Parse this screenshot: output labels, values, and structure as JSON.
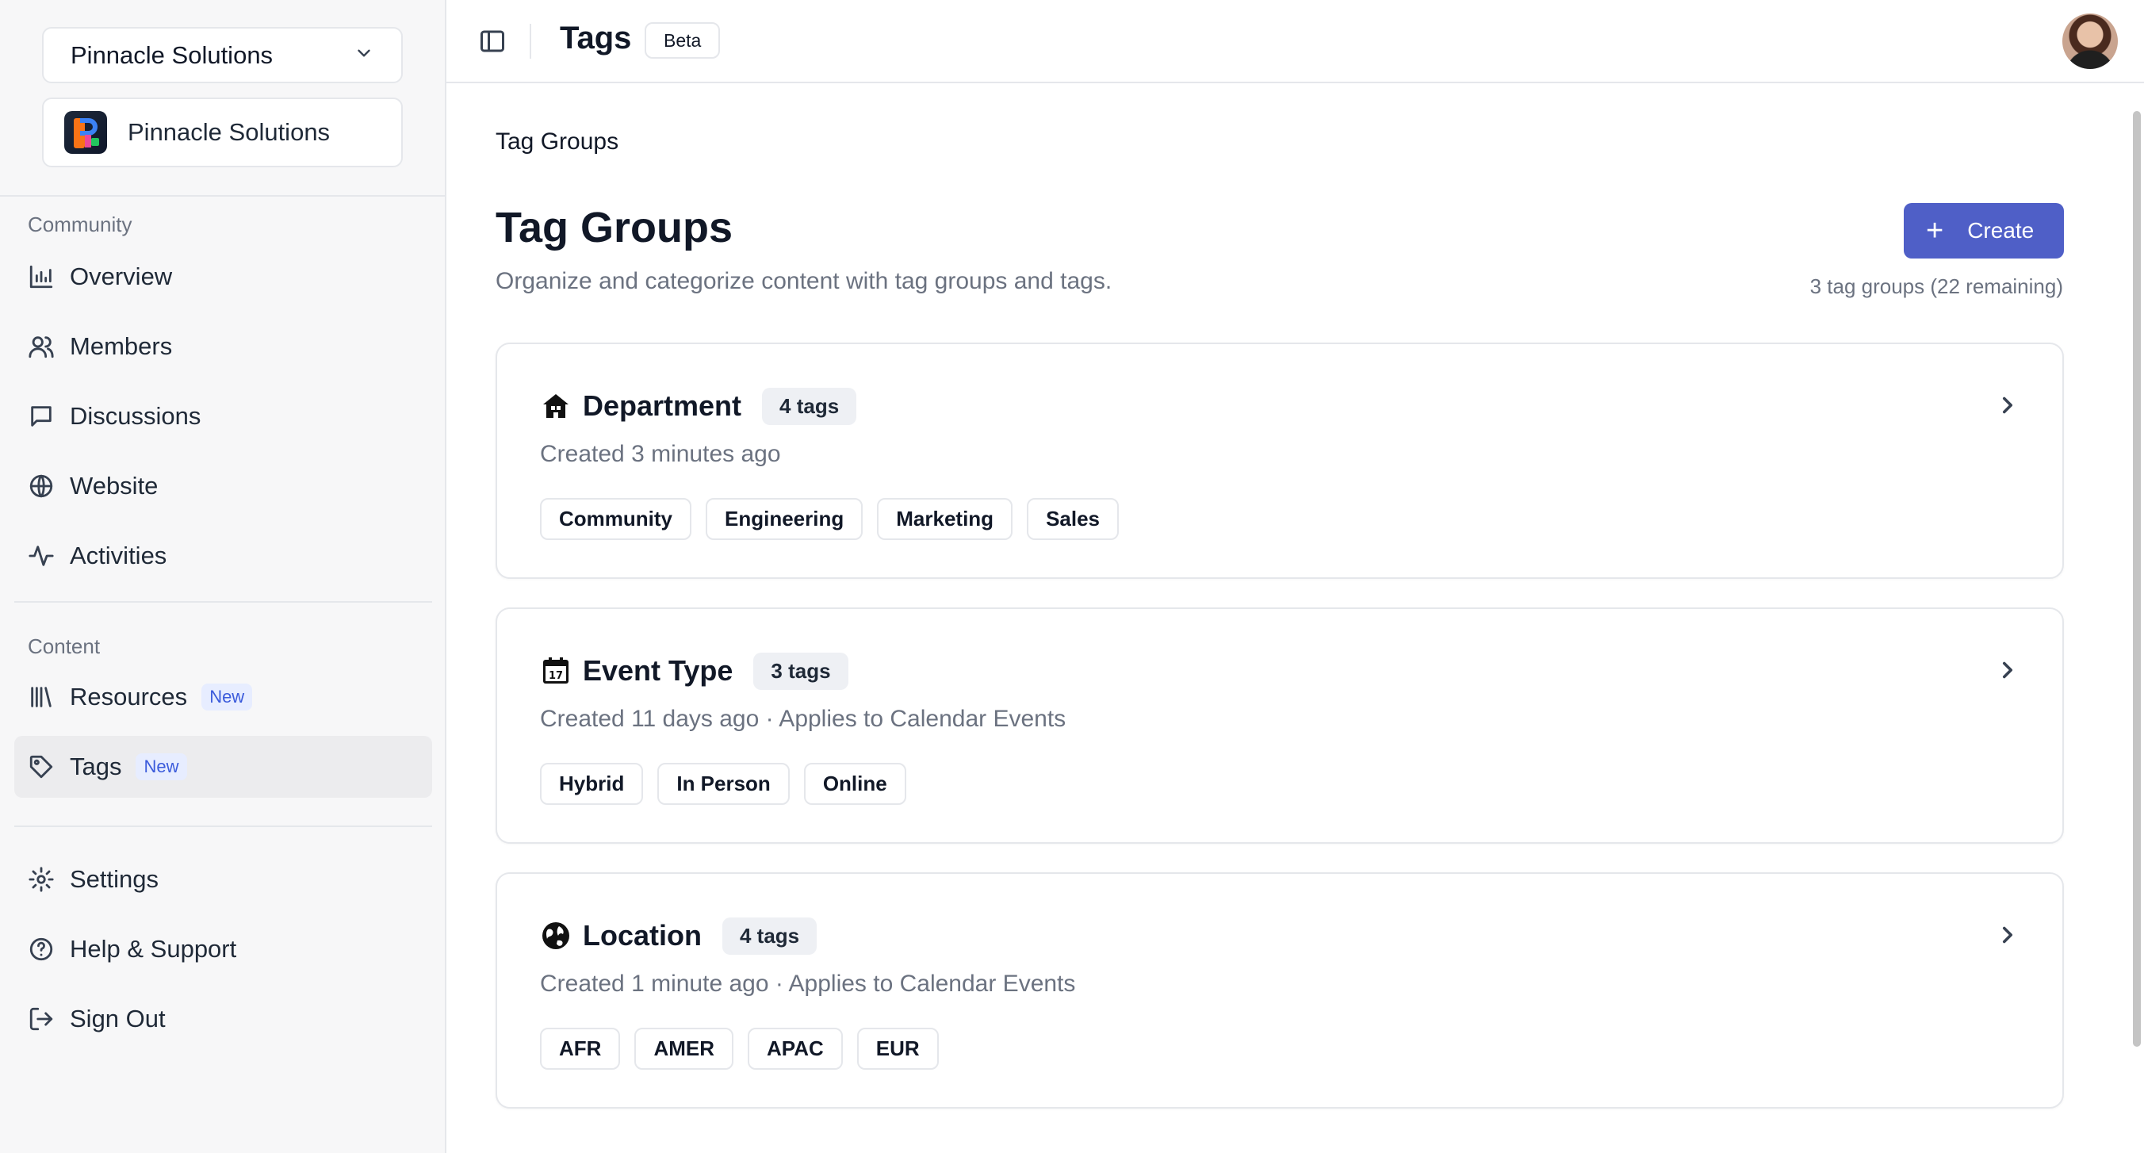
{
  "sidebar": {
    "org_selector": "Pinnacle Solutions",
    "org_card_name": "Pinnacle Solutions",
    "sections": {
      "community_label": "Community",
      "content_label": "Content"
    },
    "nav": {
      "overview": "Overview",
      "members": "Members",
      "discussions": "Discussions",
      "website": "Website",
      "activities": "Activities",
      "resources": "Resources",
      "resources_badge": "New",
      "tags": "Tags",
      "tags_badge": "New",
      "settings": "Settings",
      "help": "Help & Support",
      "signout": "Sign Out"
    },
    "active_item": "Tags"
  },
  "header": {
    "title": "Tags",
    "badge": "Beta"
  },
  "main": {
    "breadcrumb": "Tag Groups",
    "title": "Tag Groups",
    "subtitle": "Organize and categorize content with tag groups and tags.",
    "create_label": "Create",
    "count_text": "3 tag groups (22 remaining)",
    "accent_color": "#4f5fc7",
    "groups": [
      {
        "icon": "department-building-icon",
        "name": "Department",
        "count": "4 tags",
        "meta": "Created 3 minutes ago",
        "tags": [
          "Community",
          "Engineering",
          "Marketing",
          "Sales"
        ]
      },
      {
        "icon": "calendar-icon",
        "name": "Event Type",
        "count": "3 tags",
        "meta": "Created 11 days ago · Applies to Calendar Events",
        "tags": [
          "Hybrid",
          "In Person",
          "Online"
        ]
      },
      {
        "icon": "globe-icon",
        "name": "Location",
        "count": "4 tags",
        "meta": "Created 1 minute ago · Applies to Calendar Events",
        "tags": [
          "AFR",
          "AMER",
          "APAC",
          "EUR"
        ]
      }
    ]
  }
}
